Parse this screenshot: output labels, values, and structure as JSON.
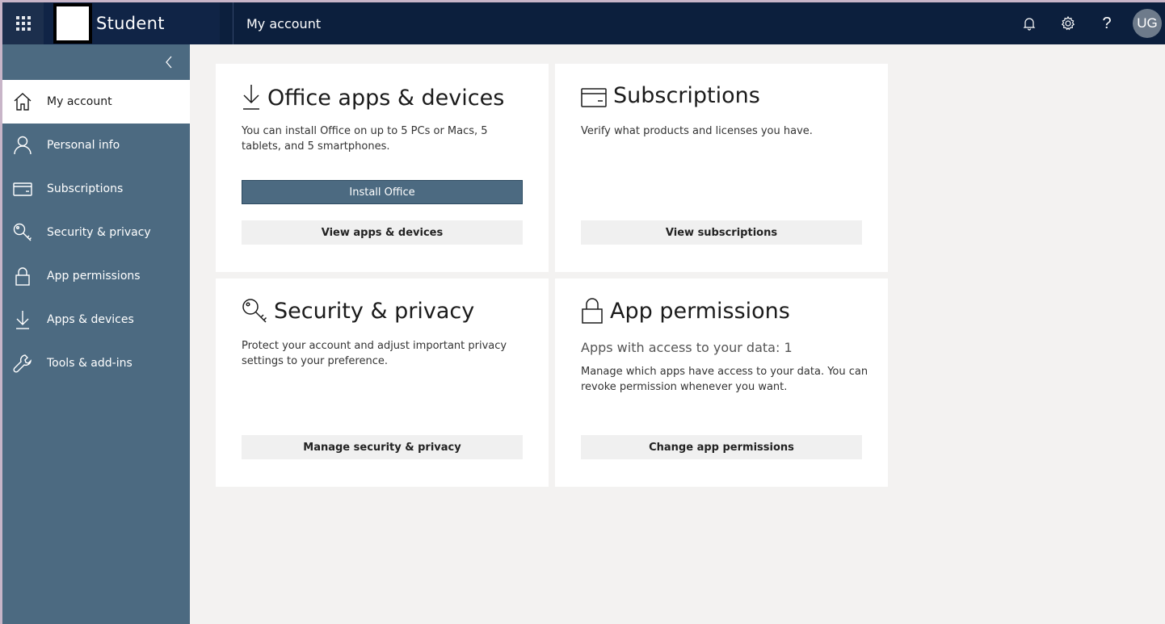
{
  "header": {
    "app_name": "Student",
    "page_title": "My account",
    "icons": [
      "waffle-icon",
      "bell-icon",
      "gear-icon",
      "help-icon"
    ],
    "help_glyph": "?",
    "avatar_initials": "UG",
    "background_color": "#0c1f3d"
  },
  "sidebar": {
    "background_color": "#4c6a81",
    "items": [
      {
        "label": "My account",
        "icon": "home-icon",
        "active": true
      },
      {
        "label": "Personal info",
        "icon": "person-icon",
        "active": false
      },
      {
        "label": "Subscriptions",
        "icon": "card-icon",
        "active": false
      },
      {
        "label": "Security & privacy",
        "icon": "key-icon",
        "active": false
      },
      {
        "label": "App permissions",
        "icon": "lock-icon",
        "active": false
      },
      {
        "label": "Apps & devices",
        "icon": "download-icon",
        "active": false
      },
      {
        "label": "Tools & add-ins",
        "icon": "wrench-icon",
        "active": false
      }
    ]
  },
  "cards": {
    "office": {
      "title": "Office apps & devices",
      "description": "You can install Office on up to 5 PCs or Macs, 5 tablets, and 5 smartphones.",
      "primary_button": "Install Office",
      "secondary_button": "View apps & devices"
    },
    "subscriptions": {
      "title": "Subscriptions",
      "description": "Verify what products and licenses you have.",
      "button": "View subscriptions"
    },
    "security": {
      "title": "Security & privacy",
      "description": "Protect your account and adjust important privacy settings to your preference.",
      "button": "Manage security & privacy"
    },
    "permissions": {
      "title": "App permissions",
      "subtitle": "Apps with access to your data: 1",
      "description": "Manage which apps have access to your data. You can revoke permission whenever you want.",
      "button": "Change app permissions"
    }
  }
}
